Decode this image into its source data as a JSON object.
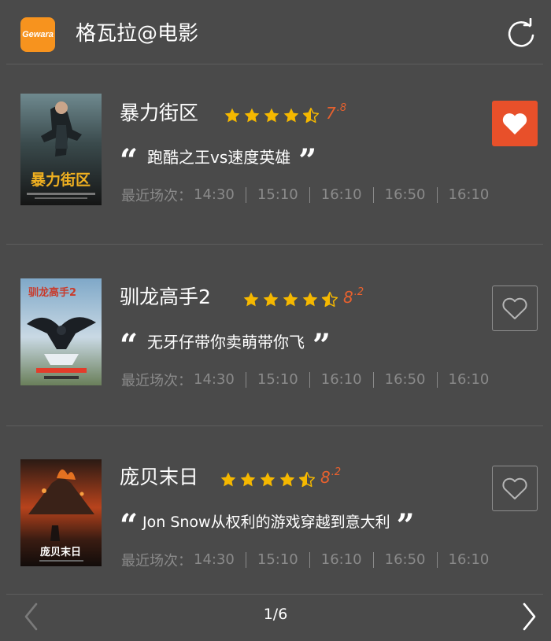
{
  "header": {
    "logo_text": "Gewara",
    "title": "格瓦拉@电影",
    "refresh_icon": "refresh-icon"
  },
  "labels": {
    "showtimes_prefix": "最近场次："
  },
  "movies": [
    {
      "title": "暴力街区",
      "rating_stars": 4.5,
      "score_int": "7",
      "score_dec": ".8",
      "tagline": "跑酷之王vs速度英雄",
      "showtimes": [
        "14:30",
        "15:10",
        "16:10",
        "16:50",
        "16:10"
      ],
      "favorited": true,
      "poster_text": "暴力街区"
    },
    {
      "title": "驯龙高手2",
      "rating_stars": 4.5,
      "score_int": "8",
      "score_dec": ".2",
      "tagline": "无牙仔带你卖萌带你飞",
      "showtimes": [
        "14:30",
        "15:10",
        "16:10",
        "16:50",
        "16:10"
      ],
      "favorited": false,
      "poster_text": "驯龙高手2"
    },
    {
      "title": "庞贝末日",
      "rating_stars": 4.5,
      "score_int": "8",
      "score_dec": ".2",
      "tagline": "Jon Snow从权利的游戏穿越到意大利",
      "showtimes": [
        "14:30",
        "15:10",
        "16:10",
        "16:50",
        "16:10"
      ],
      "favorited": false,
      "poster_text": "庞贝末日"
    }
  ],
  "pager": {
    "text": "1/6"
  },
  "colors": {
    "background": "#4a4a4a",
    "accent_orange": "#e8612e",
    "star_yellow": "#f5b800",
    "favorite_active": "#e8502a",
    "logo_orange": "#f7931e"
  }
}
